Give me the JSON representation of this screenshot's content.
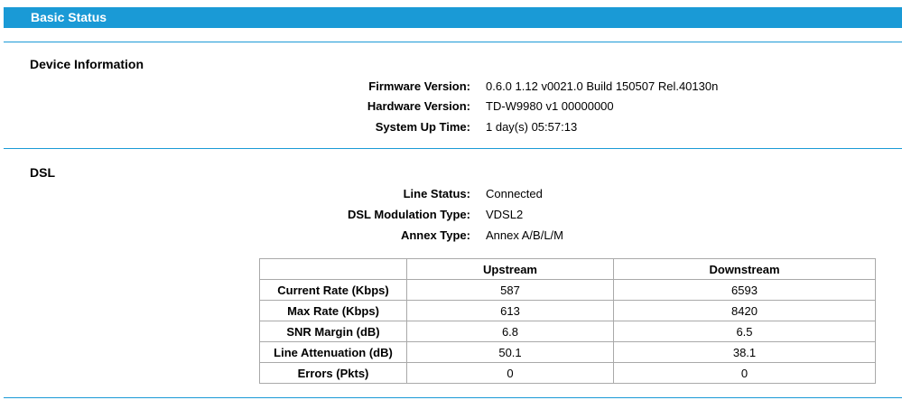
{
  "header": {
    "title": "Basic Status"
  },
  "device_info": {
    "title": "Device Information",
    "rows": [
      {
        "label": "Firmware Version:",
        "value": "0.6.0 1.12 v0021.0 Build 150507 Rel.40130n"
      },
      {
        "label": "Hardware Version:",
        "value": "TD-W9980 v1 00000000"
      },
      {
        "label": "System Up Time:",
        "value": "1 day(s) 05:57:13"
      }
    ]
  },
  "dsl": {
    "title": "DSL",
    "rows": [
      {
        "label": "Line Status:",
        "value": "Connected"
      },
      {
        "label": "DSL Modulation Type:",
        "value": "VDSL2"
      },
      {
        "label": "Annex Type:",
        "value": "Annex A/B/L/M"
      }
    ],
    "table": {
      "headers": [
        "",
        "Upstream",
        "Downstream"
      ],
      "rows": [
        {
          "label": "Current Rate (Kbps)",
          "up": "587",
          "down": "6593"
        },
        {
          "label": "Max Rate (Kbps)",
          "up": "613",
          "down": "8420"
        },
        {
          "label": "SNR Margin (dB)",
          "up": "6.8",
          "down": "6.5"
        },
        {
          "label": "Line Attenuation (dB)",
          "up": "50.1",
          "down": "38.1"
        },
        {
          "label": "Errors (Pkts)",
          "up": "0",
          "down": "0"
        }
      ]
    }
  }
}
